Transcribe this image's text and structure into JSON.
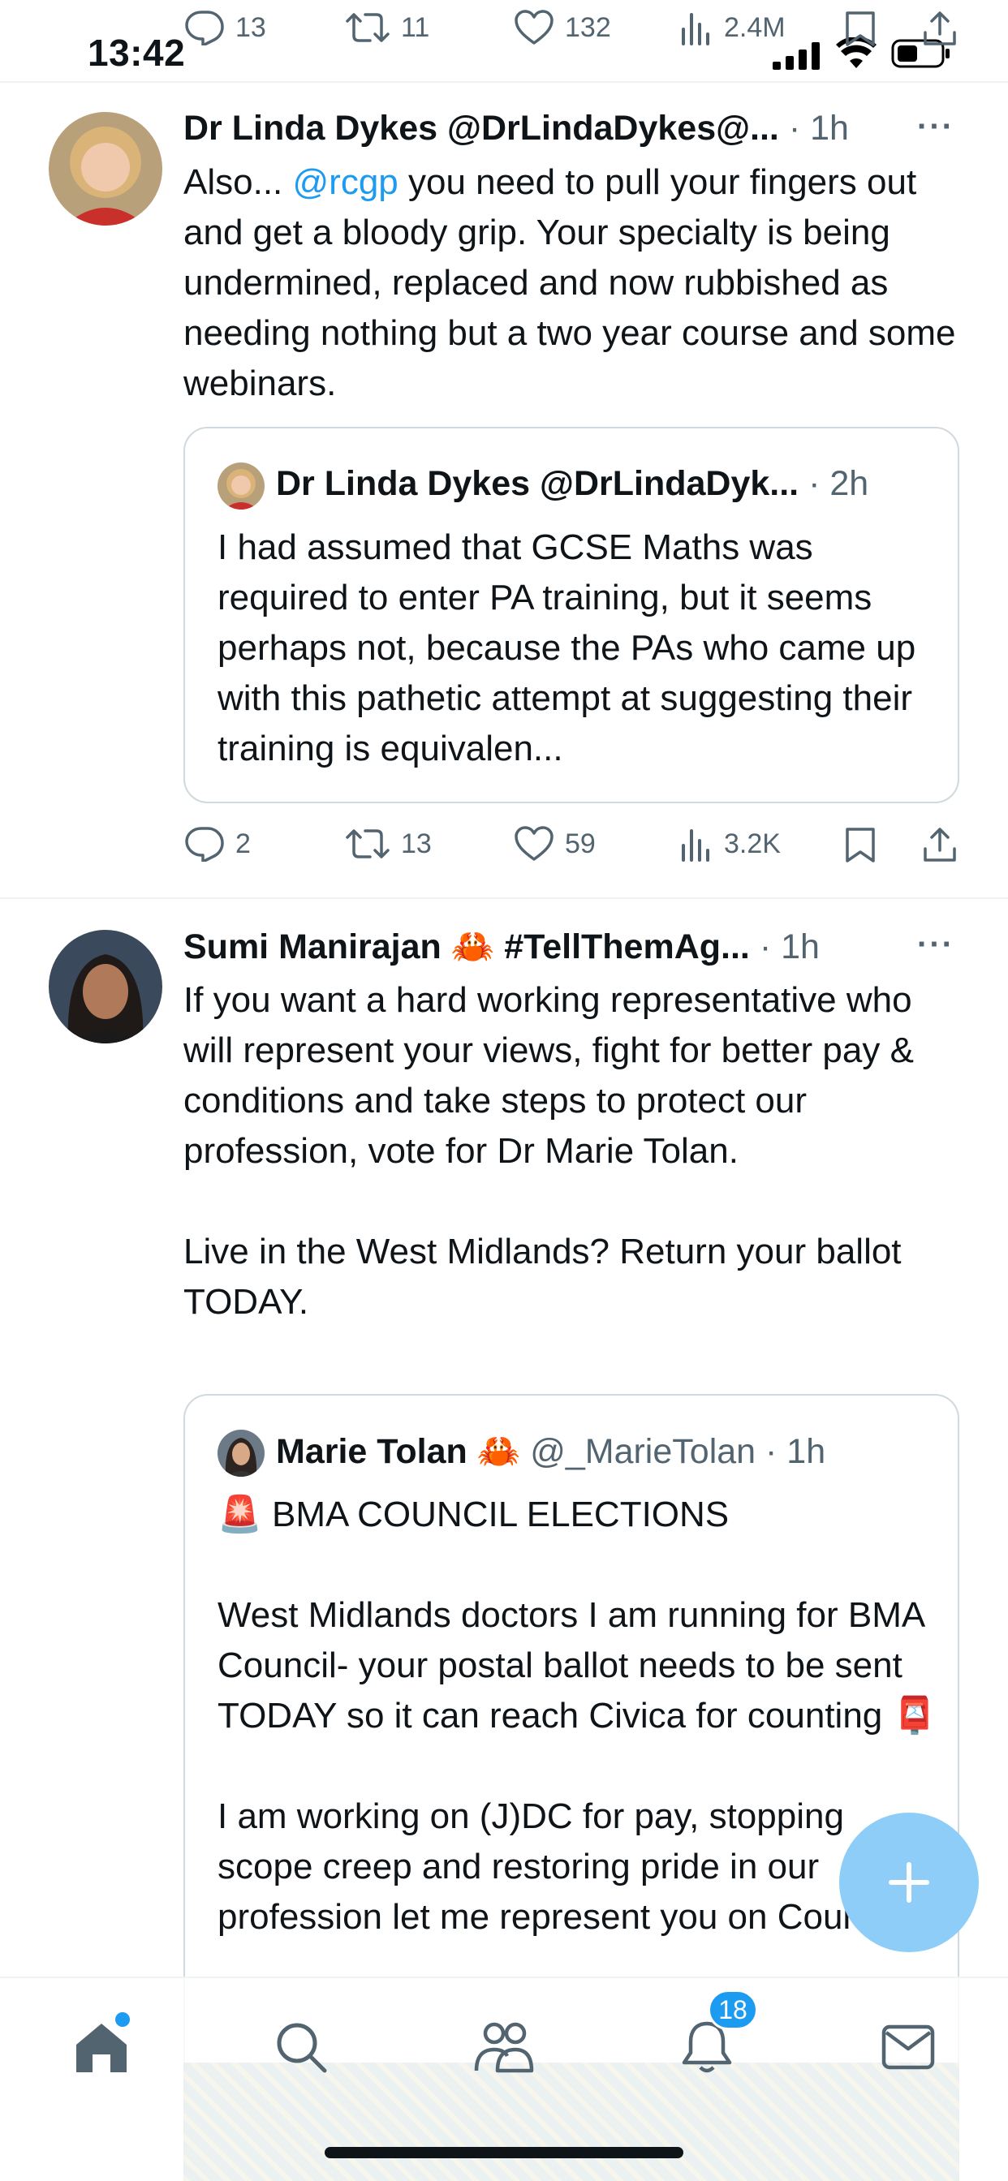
{
  "status_bar": {
    "time": "13:42"
  },
  "top_action_row": {
    "replies": "13",
    "reposts": "11",
    "likes": "132",
    "views": "2.4M"
  },
  "tweets": [
    {
      "author_name": "Dr Linda Dykes",
      "author_handle": "@DrLindaDykes@...",
      "time": "1h",
      "text_before_mention": "Also... ",
      "mention": "@rcgp",
      "text_after_mention": " you need to pull your fingers out and get a bloody grip. Your specialty is being undermined, replaced and now rubbished as needing nothing but a two year course and some webinars.",
      "quote": {
        "author_name": "Dr Linda Dykes",
        "author_handle": "@DrLindaDyk...",
        "time": "2h",
        "text": "I had assumed that GCSE Maths was required to enter PA training, but it seems perhaps not, because the PAs who came up with this pathetic attempt at suggesting their training is equivalen..."
      },
      "actions": {
        "replies": "2",
        "reposts": "13",
        "likes": "59",
        "views": "3.2K"
      }
    },
    {
      "author_name": "Sumi Manirajan 🦀 #TellThemAg...",
      "time": "1h",
      "text": "If you want a hard working representative who will represent your views, fight for better pay & conditions and take steps to protect our profession, vote for Dr Marie Tolan.\n\nLive in the West Midlands? Return your ballot TODAY.",
      "quote": {
        "author_name": "Marie Tolan 🦀",
        "author_handle": "@_MarieTolan",
        "time": "1h",
        "text": "🚨 BMA COUNCIL ELECTIONS\n\nWest Midlands doctors I am running for BMA Council- your postal ballot needs to be sent TODAY so it can reach Civica for counting 📮\n\nI am working on (J)DC for pay, stopping scope creep and restoring pride in our profession let me represent you on Council"
      }
    }
  ],
  "bottom_nav": {
    "notifications_badge": "18"
  },
  "colors": {
    "accent": "#1d9bf0",
    "muted": "#536471",
    "text": "#0f1419",
    "fab": "#8ecdf7"
  },
  "icons": [
    "reply-icon",
    "repost-icon",
    "like-icon",
    "views-icon",
    "bookmark-icon",
    "share-icon",
    "more-icon",
    "home-icon",
    "search-icon",
    "communities-icon",
    "notifications-icon",
    "messages-icon",
    "compose-icon"
  ]
}
